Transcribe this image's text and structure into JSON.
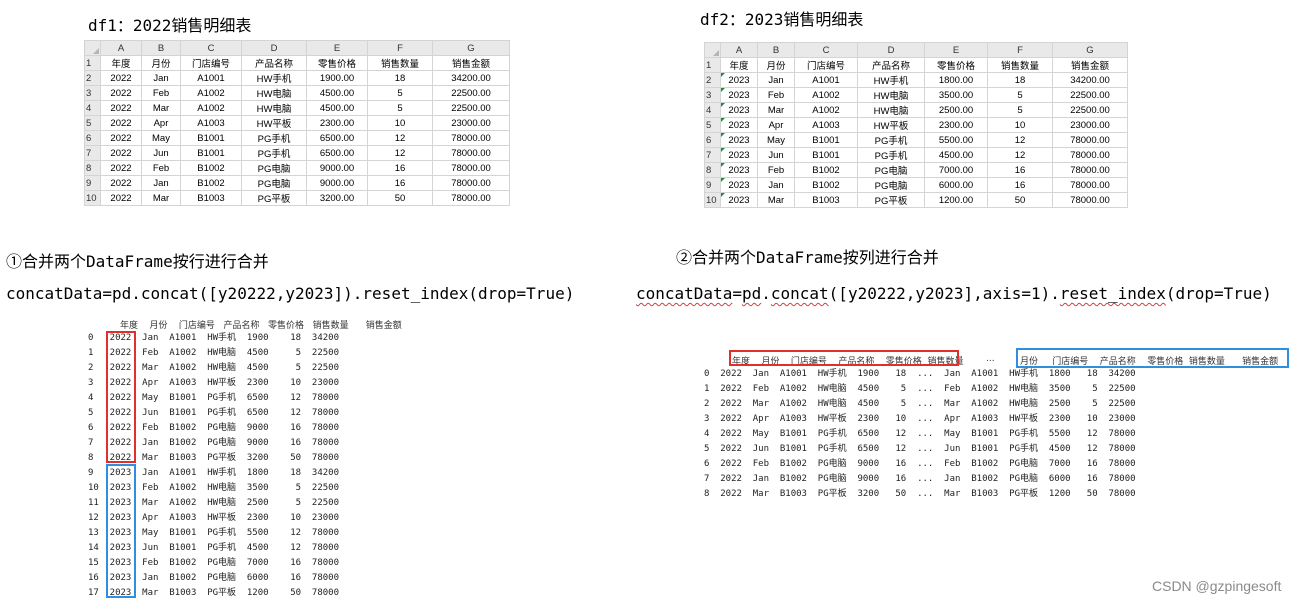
{
  "df1": {
    "title": "df1：2022销售明细表",
    "col_letters": [
      "A",
      "B",
      "C",
      "D",
      "E",
      "F",
      "G"
    ],
    "rows": [
      [
        "年度",
        "月份",
        "门店编号",
        "产品名称",
        "零售价格",
        "销售数量",
        "销售金额"
      ],
      [
        "2022",
        "Jan",
        "A1001",
        "HW手机",
        "1900.00",
        "18",
        "34200.00"
      ],
      [
        "2022",
        "Feb",
        "A1002",
        "HW电脑",
        "4500.00",
        "5",
        "22500.00"
      ],
      [
        "2022",
        "Mar",
        "A1002",
        "HW电脑",
        "4500.00",
        "5",
        "22500.00"
      ],
      [
        "2022",
        "Apr",
        "A1003",
        "HW平板",
        "2300.00",
        "10",
        "23000.00"
      ],
      [
        "2022",
        "May",
        "B1001",
        "PG手机",
        "6500.00",
        "12",
        "78000.00"
      ],
      [
        "2022",
        "Jun",
        "B1001",
        "PG手机",
        "6500.00",
        "12",
        "78000.00"
      ],
      [
        "2022",
        "Feb",
        "B1002",
        "PG电脑",
        "9000.00",
        "16",
        "78000.00"
      ],
      [
        "2022",
        "Jan",
        "B1002",
        "PG电脑",
        "9000.00",
        "16",
        "78000.00"
      ],
      [
        "2022",
        "Mar",
        "B1003",
        "PG平板",
        "3200.00",
        "50",
        "78000.00"
      ]
    ]
  },
  "df2": {
    "title": "df2：2023销售明细表",
    "col_letters": [
      "A",
      "B",
      "C",
      "D",
      "E",
      "F",
      "G"
    ],
    "rows": [
      [
        "年度",
        "月份",
        "门店编号",
        "产品名称",
        "零售价格",
        "销售数量",
        "销售金额"
      ],
      [
        "2023",
        "Jan",
        "A1001",
        "HW手机",
        "1800.00",
        "18",
        "34200.00"
      ],
      [
        "2023",
        "Feb",
        "A1002",
        "HW电脑",
        "3500.00",
        "5",
        "22500.00"
      ],
      [
        "2023",
        "Mar",
        "A1002",
        "HW电脑",
        "2500.00",
        "5",
        "22500.00"
      ],
      [
        "2023",
        "Apr",
        "A1003",
        "HW平板",
        "2300.00",
        "10",
        "23000.00"
      ],
      [
        "2023",
        "May",
        "B1001",
        "PG手机",
        "5500.00",
        "12",
        "78000.00"
      ],
      [
        "2023",
        "Jun",
        "B1001",
        "PG手机",
        "4500.00",
        "12",
        "78000.00"
      ],
      [
        "2023",
        "Feb",
        "B1002",
        "PG电脑",
        "7000.00",
        "16",
        "78000.00"
      ],
      [
        "2023",
        "Jan",
        "B1002",
        "PG电脑",
        "6000.00",
        "16",
        "78000.00"
      ],
      [
        "2023",
        "Mar",
        "B1003",
        "PG平板",
        "1200.00",
        "50",
        "78000.00"
      ]
    ]
  },
  "section1": {
    "heading": "①合并两个DataFrame按行进行合并",
    "code": "concatData=pd.concat([y20222,y2023]).reset_index(drop=True)"
  },
  "section2": {
    "heading": "②合并两个DataFrame按列进行合并",
    "code_parts": [
      "concatData",
      "=",
      "pd",
      ".",
      "concat",
      "([y20222,y2023],axis=1).",
      "reset_index",
      "(drop=True)"
    ]
  },
  "out1": {
    "header": "年度    月份    门店编号   产品名称   零售价格   销售数量      销售金额",
    "lines": [
      "0   2022  Jan  A1001  HW手机  1900    18  34200",
      "1   2022  Feb  A1002  HW电脑  4500     5  22500",
      "2   2022  Mar  A1002  HW电脑  4500     5  22500",
      "3   2022  Apr  A1003  HW平板  2300    10  23000",
      "4   2022  May  B1001  PG手机  6500    12  78000",
      "5   2022  Jun  B1001  PG手机  6500    12  78000",
      "6   2022  Feb  B1002  PG电脑  9000    16  78000",
      "7   2022  Jan  B1002  PG电脑  9000    16  78000",
      "8   2022  Mar  B1003  PG平板  3200    50  78000",
      "9   2023  Jan  A1001  HW手机  1800    18  34200",
      "10  2023  Feb  A1002  HW电脑  3500     5  22500",
      "11  2023  Mar  A1002  HW电脑  2500     5  22500",
      "12  2023  Apr  A1003  HW平板  2300    10  23000",
      "13  2023  May  B1001  PG手机  5500    12  78000",
      "14  2023  Jun  B1001  PG手机  4500    12  78000",
      "15  2023  Feb  B1002  PG电脑  7000    16  78000",
      "16  2023  Jan  B1002  PG电脑  6000    16  78000",
      "17  2023  Mar  B1003  PG平板  1200    50  78000"
    ]
  },
  "out2": {
    "header_left": "年度    月份    门店编号    产品名称    零售价格  销售数量",
    "header_mid": "...",
    "header_right": "月份     门店编号    产品名称    零售价格  销售数量      销售金额",
    "lines": [
      "0  2022  Jan  A1001  HW手机  1900   18  ...  Jan  A1001  HW手机  1800   18  34200",
      "1  2022  Feb  A1002  HW电脑  4500    5  ...  Feb  A1002  HW电脑  3500    5  22500",
      "2  2022  Mar  A1002  HW电脑  4500    5  ...  Mar  A1002  HW电脑  2500    5  22500",
      "3  2022  Apr  A1003  HW平板  2300   10  ...  Apr  A1003  HW平板  2300   10  23000",
      "4  2022  May  B1001  PG手机  6500   12  ...  May  B1001  PG手机  5500   12  78000",
      "5  2022  Jun  B1001  PG手机  6500   12  ...  Jun  B1001  PG手机  4500   12  78000",
      "6  2022  Feb  B1002  PG电脑  9000   16  ...  Feb  B1002  PG电脑  7000   16  78000",
      "7  2022  Jan  B1002  PG电脑  9000   16  ...  Jan  B1002  PG电脑  6000   16  78000",
      "8  2022  Mar  B1003  PG平板  3200   50  ...  Mar  B1003  PG平板  1200   50  78000"
    ]
  },
  "watermark": "CSDN @gzpingesoft"
}
